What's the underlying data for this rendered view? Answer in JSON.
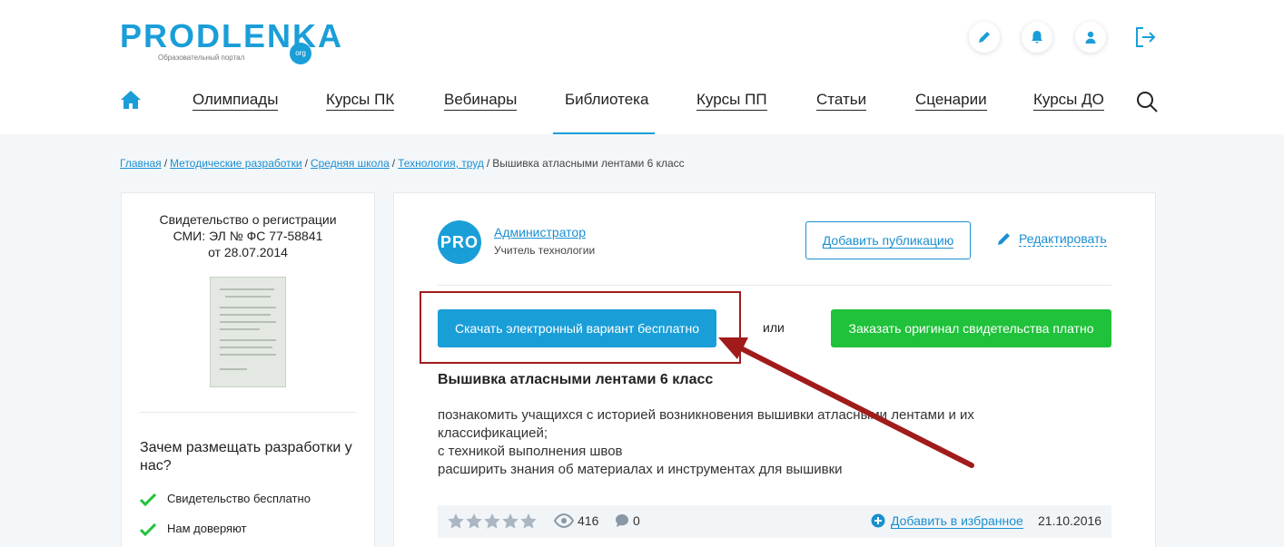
{
  "header": {
    "logo_text": "PRODLENKA",
    "logo_subtitle": "Образовательный портал",
    "logo_org": "org",
    "icons": [
      "pencil-icon",
      "bell-icon",
      "user-icon",
      "logout-icon"
    ]
  },
  "nav": {
    "items": [
      "Олимпиады",
      "Курсы ПК",
      "Вебинары",
      "Библиотека",
      "Курсы ПП",
      "Статьи",
      "Сценарии",
      "Курсы ДО"
    ],
    "active": "Библиотека"
  },
  "breadcrumb": {
    "links": [
      "Главная",
      "Методические разработки",
      "Средняя школа",
      "Технология, труд"
    ],
    "current": "Вышивка атласными лентами 6 класс"
  },
  "sidebar": {
    "cert_line1": "Свидетельство о регистрации",
    "cert_line2": "СМИ: ЭЛ № ФС 77-58841",
    "cert_line3": "от 28.07.2014",
    "why_title": "Зачем размещать разработки у нас?",
    "why_items": [
      "Свидетельство бесплатно",
      "Нам доверяют"
    ]
  },
  "card": {
    "avatar_text": "PRO",
    "author_name": "Администратор",
    "author_role": "Учитель технологии",
    "add_publication": "Добавить публикацию",
    "edit": "Редактировать",
    "download_free": "Скачать электронный вариант бесплатно",
    "or": "или",
    "order_original": "Заказать оригинал свидетельства платно",
    "title": "Вышивка атласными лентами 6 класс",
    "description": [
      "познакомить учащихся с историей возникновения вышивки атласными лентами и их классификацией;",
      "с техникой выполнения швов",
      "расширить знания об материалах и инструментах для вышивки"
    ],
    "rating": 0,
    "views": "416",
    "comments": "0",
    "add_favorite": "Добавить в избранное",
    "date": "21.10.2016"
  },
  "colors": {
    "brand_blue": "#1a9ed8",
    "green": "#1fc23a",
    "annotation_red": "#a11b1b"
  }
}
